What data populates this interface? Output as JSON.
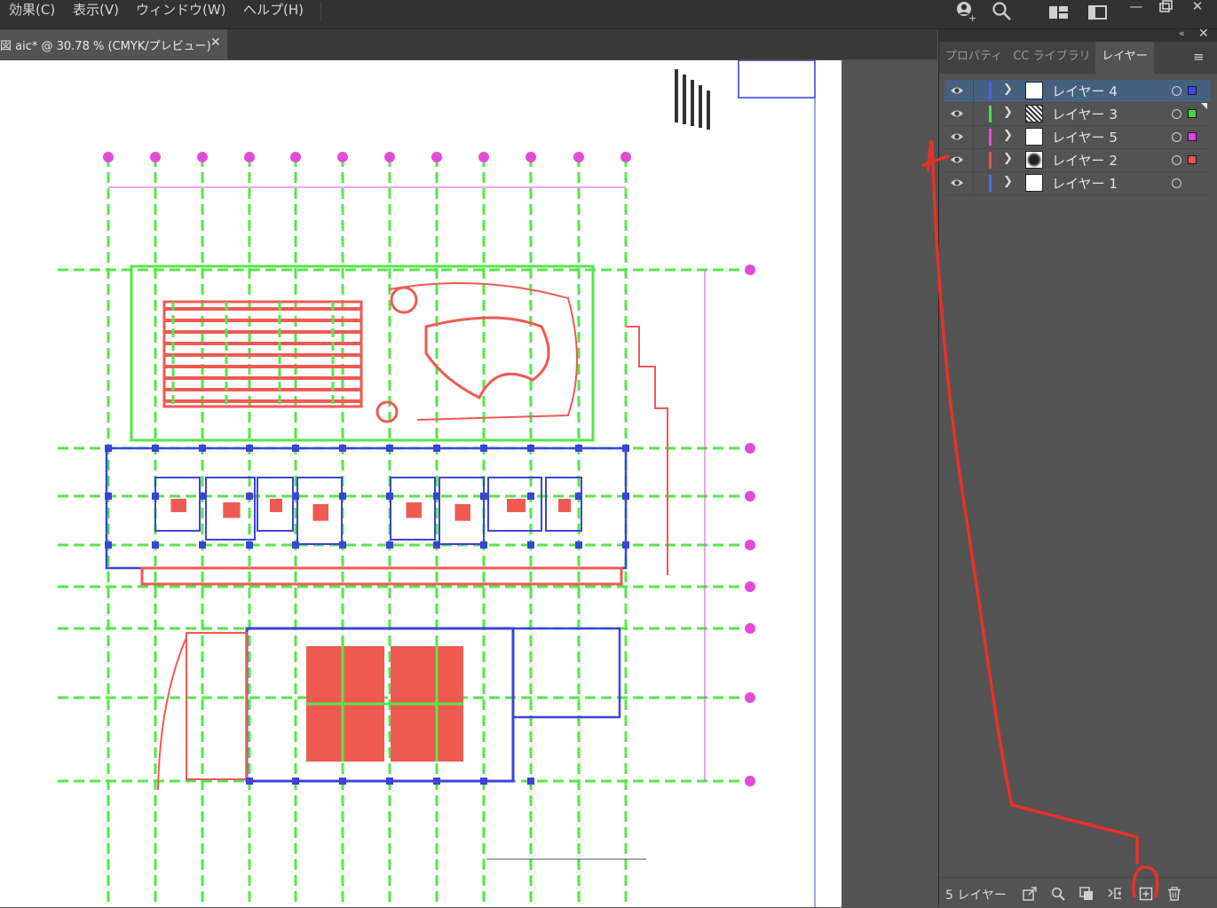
{
  "menu": [
    {
      "label": "効果(C)",
      "name": "menu-effect"
    },
    {
      "label": "表示(V)",
      "name": "menu-view"
    },
    {
      "label": "ウィンドウ(W)",
      "name": "menu-window"
    },
    {
      "label": "ヘルプ(H)",
      "name": "menu-help"
    }
  ],
  "document": {
    "tab_title": "図 aic* @ 30.78 % (CMYK/プレビュー)",
    "close_glyph": "✕"
  },
  "panel": {
    "tabs": [
      "プロパティ",
      "CC ライブラリ",
      "レイヤー"
    ],
    "active_tab": "レイヤー",
    "collapse_glyph": "«",
    "close_glyph": "✕",
    "menu_glyph": "≡",
    "layers": [
      {
        "name": "レイヤー 4",
        "color": "#4f5cff",
        "selected": true,
        "square": true,
        "square_color": "#3a46ff"
      },
      {
        "name": "レイヤー 3",
        "color": "#4be04b",
        "selected": false,
        "square": true,
        "square_color": "#3fd63f"
      },
      {
        "name": "レイヤー 5",
        "color": "#e14be0",
        "selected": false,
        "square": true,
        "square_color": "#e040e0"
      },
      {
        "name": "レイヤー 2",
        "color": "#e8534a",
        "selected": false,
        "square": true,
        "square_color": "#f25050"
      },
      {
        "name": "レイヤー 1",
        "color": "#4f6bff",
        "selected": false,
        "square": false,
        "square_color": ""
      }
    ],
    "footer": {
      "count_label": "5 レイヤー",
      "icons": [
        "export-icon",
        "search-icon",
        "clip-icon",
        "sublayer-icon",
        "new-layer-icon",
        "trash-icon"
      ]
    }
  },
  "colors": {
    "accent_red": "#e8312a",
    "plan_green": "#55e64a",
    "plan_red": "#ee5a52",
    "plan_blue": "#3a44d8",
    "plan_magenta": "#e24bd8"
  }
}
